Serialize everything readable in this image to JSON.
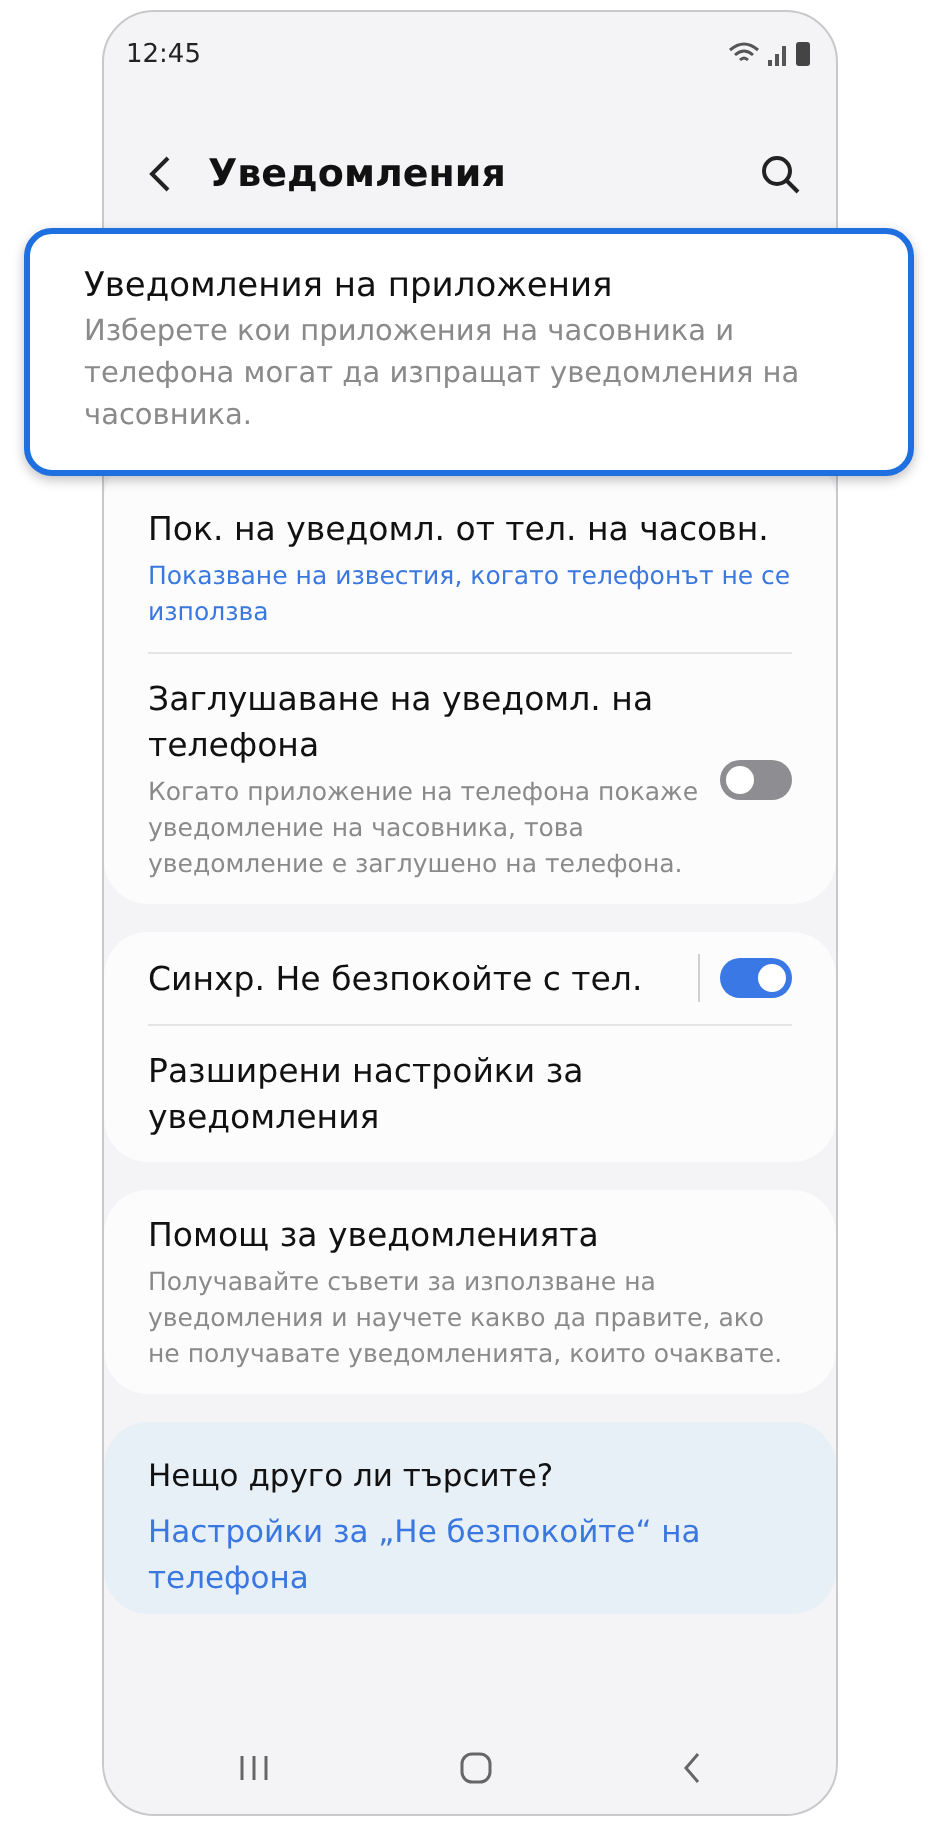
{
  "status_bar": {
    "time": "12:45"
  },
  "header": {
    "title": "Уведомления"
  },
  "featured": {
    "title": "Уведомления на приложения",
    "description": "Изберете кои приложения на часовника и телефона могат да изпращат уведомления на часовника."
  },
  "groups": [
    {
      "items": [
        {
          "kind": "link",
          "title": "Пок. на уведомл. от тел. на часовн.",
          "subtitle": "Показване на известия, когато телефонът не се използва",
          "accent": true
        },
        {
          "kind": "toggle",
          "title": "Заглушаване на уведомл. на телефона",
          "subtitle": "Когато приложение на телефона покаже уведомление на часовника, това уведомление е заглушено на телефона.",
          "accent": false,
          "on": false
        }
      ]
    },
    {
      "items": [
        {
          "kind": "toggle",
          "title": "Синхр. Не безпокойте с тел.",
          "on": true
        },
        {
          "kind": "link",
          "title": "Разширени настройки за уведомления"
        }
      ]
    },
    {
      "items": [
        {
          "kind": "link",
          "title": "Помощ за уведомленията",
          "subtitle": "Получавайте съвети за използване на уведомления и научете какво да правите, ако не получавате уведомленията, които очаквате.",
          "accent": false
        }
      ]
    }
  ],
  "suggestions": {
    "title": "Нещо друго ли търсите?",
    "links": [
      "Настройки за „Не безпокойте“ на телефона"
    ]
  }
}
